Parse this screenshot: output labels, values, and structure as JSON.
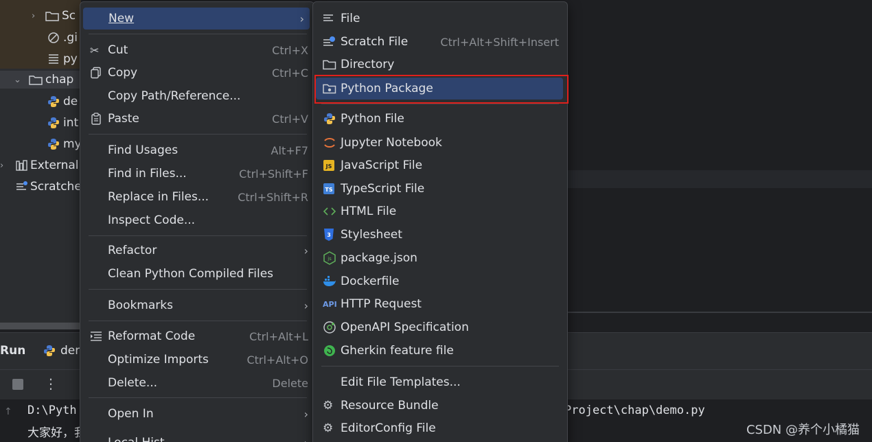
{
  "colors": {
    "ide_bg": "#1e1f22",
    "panel_bg": "#2b2d30",
    "menu_bg": "#2b2d30",
    "highlight": "#2e436e",
    "shortcut": "#8c8f94",
    "red_outline": "#e0201c"
  },
  "project_tree": {
    "items": [
      {
        "label": "Sc",
        "icon": "folder-icon"
      },
      {
        "label": ".gi",
        "icon": "gitignore-icon"
      },
      {
        "label": "py",
        "icon": "text-file-icon"
      },
      {
        "label": "chap",
        "icon": "folder-icon"
      },
      {
        "label": "de",
        "icon": "python-icon"
      },
      {
        "label": "int",
        "icon": "python-icon"
      },
      {
        "label": "my",
        "icon": "python-icon"
      },
      {
        "label": "External",
        "icon": "library-icon"
      },
      {
        "label": "Scratche",
        "icon": "scratch-icon"
      }
    ]
  },
  "run_panel": {
    "title": "Run",
    "tab_label": "der"
  },
  "console": {
    "line1_left": "D:\\Pyth",
    "line1_right": "Project\\chap\\demo.py",
    "line2_left": "大家好，我"
  },
  "context_menu": {
    "items": [
      {
        "label": "New"
      },
      {
        "label": "Cut",
        "shortcut": "Ctrl+X"
      },
      {
        "label": "Copy",
        "shortcut": "Ctrl+C"
      },
      {
        "label": "Copy Path/Reference..."
      },
      {
        "label": "Paste",
        "shortcut": "Ctrl+V"
      },
      {
        "label": "Find Usages",
        "shortcut": "Alt+F7"
      },
      {
        "label": "Find in Files...",
        "shortcut": "Ctrl+Shift+F"
      },
      {
        "label": "Replace in Files...",
        "shortcut": "Ctrl+Shift+R"
      },
      {
        "label": "Inspect Code..."
      },
      {
        "label": "Refactor"
      },
      {
        "label": "Clean Python Compiled Files"
      },
      {
        "label": "Bookmarks"
      },
      {
        "label": "Reformat Code",
        "shortcut": "Ctrl+Alt+L"
      },
      {
        "label": "Optimize Imports",
        "shortcut": "Ctrl+Alt+O"
      },
      {
        "label": "Delete...",
        "shortcut": "Delete"
      },
      {
        "label": "Open In"
      },
      {
        "label": "Local Hist"
      }
    ]
  },
  "new_submenu": {
    "items": [
      {
        "label": "File",
        "icon": "file-icon"
      },
      {
        "label": "Scratch File",
        "shortcut": "Ctrl+Alt+Shift+Insert",
        "icon": "scratch-file-icon"
      },
      {
        "label": "Directory",
        "icon": "directory-icon"
      },
      {
        "label": "Python Package",
        "icon": "python-package-icon"
      },
      {
        "label": "Python File",
        "icon": "python-icon"
      },
      {
        "label": "Jupyter Notebook",
        "icon": "jupyter-icon"
      },
      {
        "label": "JavaScript File",
        "icon": "javascript-icon"
      },
      {
        "label": "TypeScript File",
        "icon": "typescript-icon"
      },
      {
        "label": "HTML File",
        "icon": "html-icon"
      },
      {
        "label": "Stylesheet",
        "icon": "css-icon"
      },
      {
        "label": "package.json",
        "icon": "nodejs-icon"
      },
      {
        "label": "Dockerfile",
        "icon": "docker-icon"
      },
      {
        "label": "HTTP Request",
        "icon": "api-icon"
      },
      {
        "label": "OpenAPI Specification",
        "icon": "openapi-icon"
      },
      {
        "label": "Gherkin feature file",
        "icon": "gherkin-icon"
      },
      {
        "label": "Edit File Templates...",
        "icon": ""
      },
      {
        "label": "Resource Bundle",
        "icon": "gear-icon"
      },
      {
        "label": "EditorConfig File",
        "icon": "gear-icon"
      }
    ]
  },
  "watermark": "CSDN @养个小橘猫"
}
